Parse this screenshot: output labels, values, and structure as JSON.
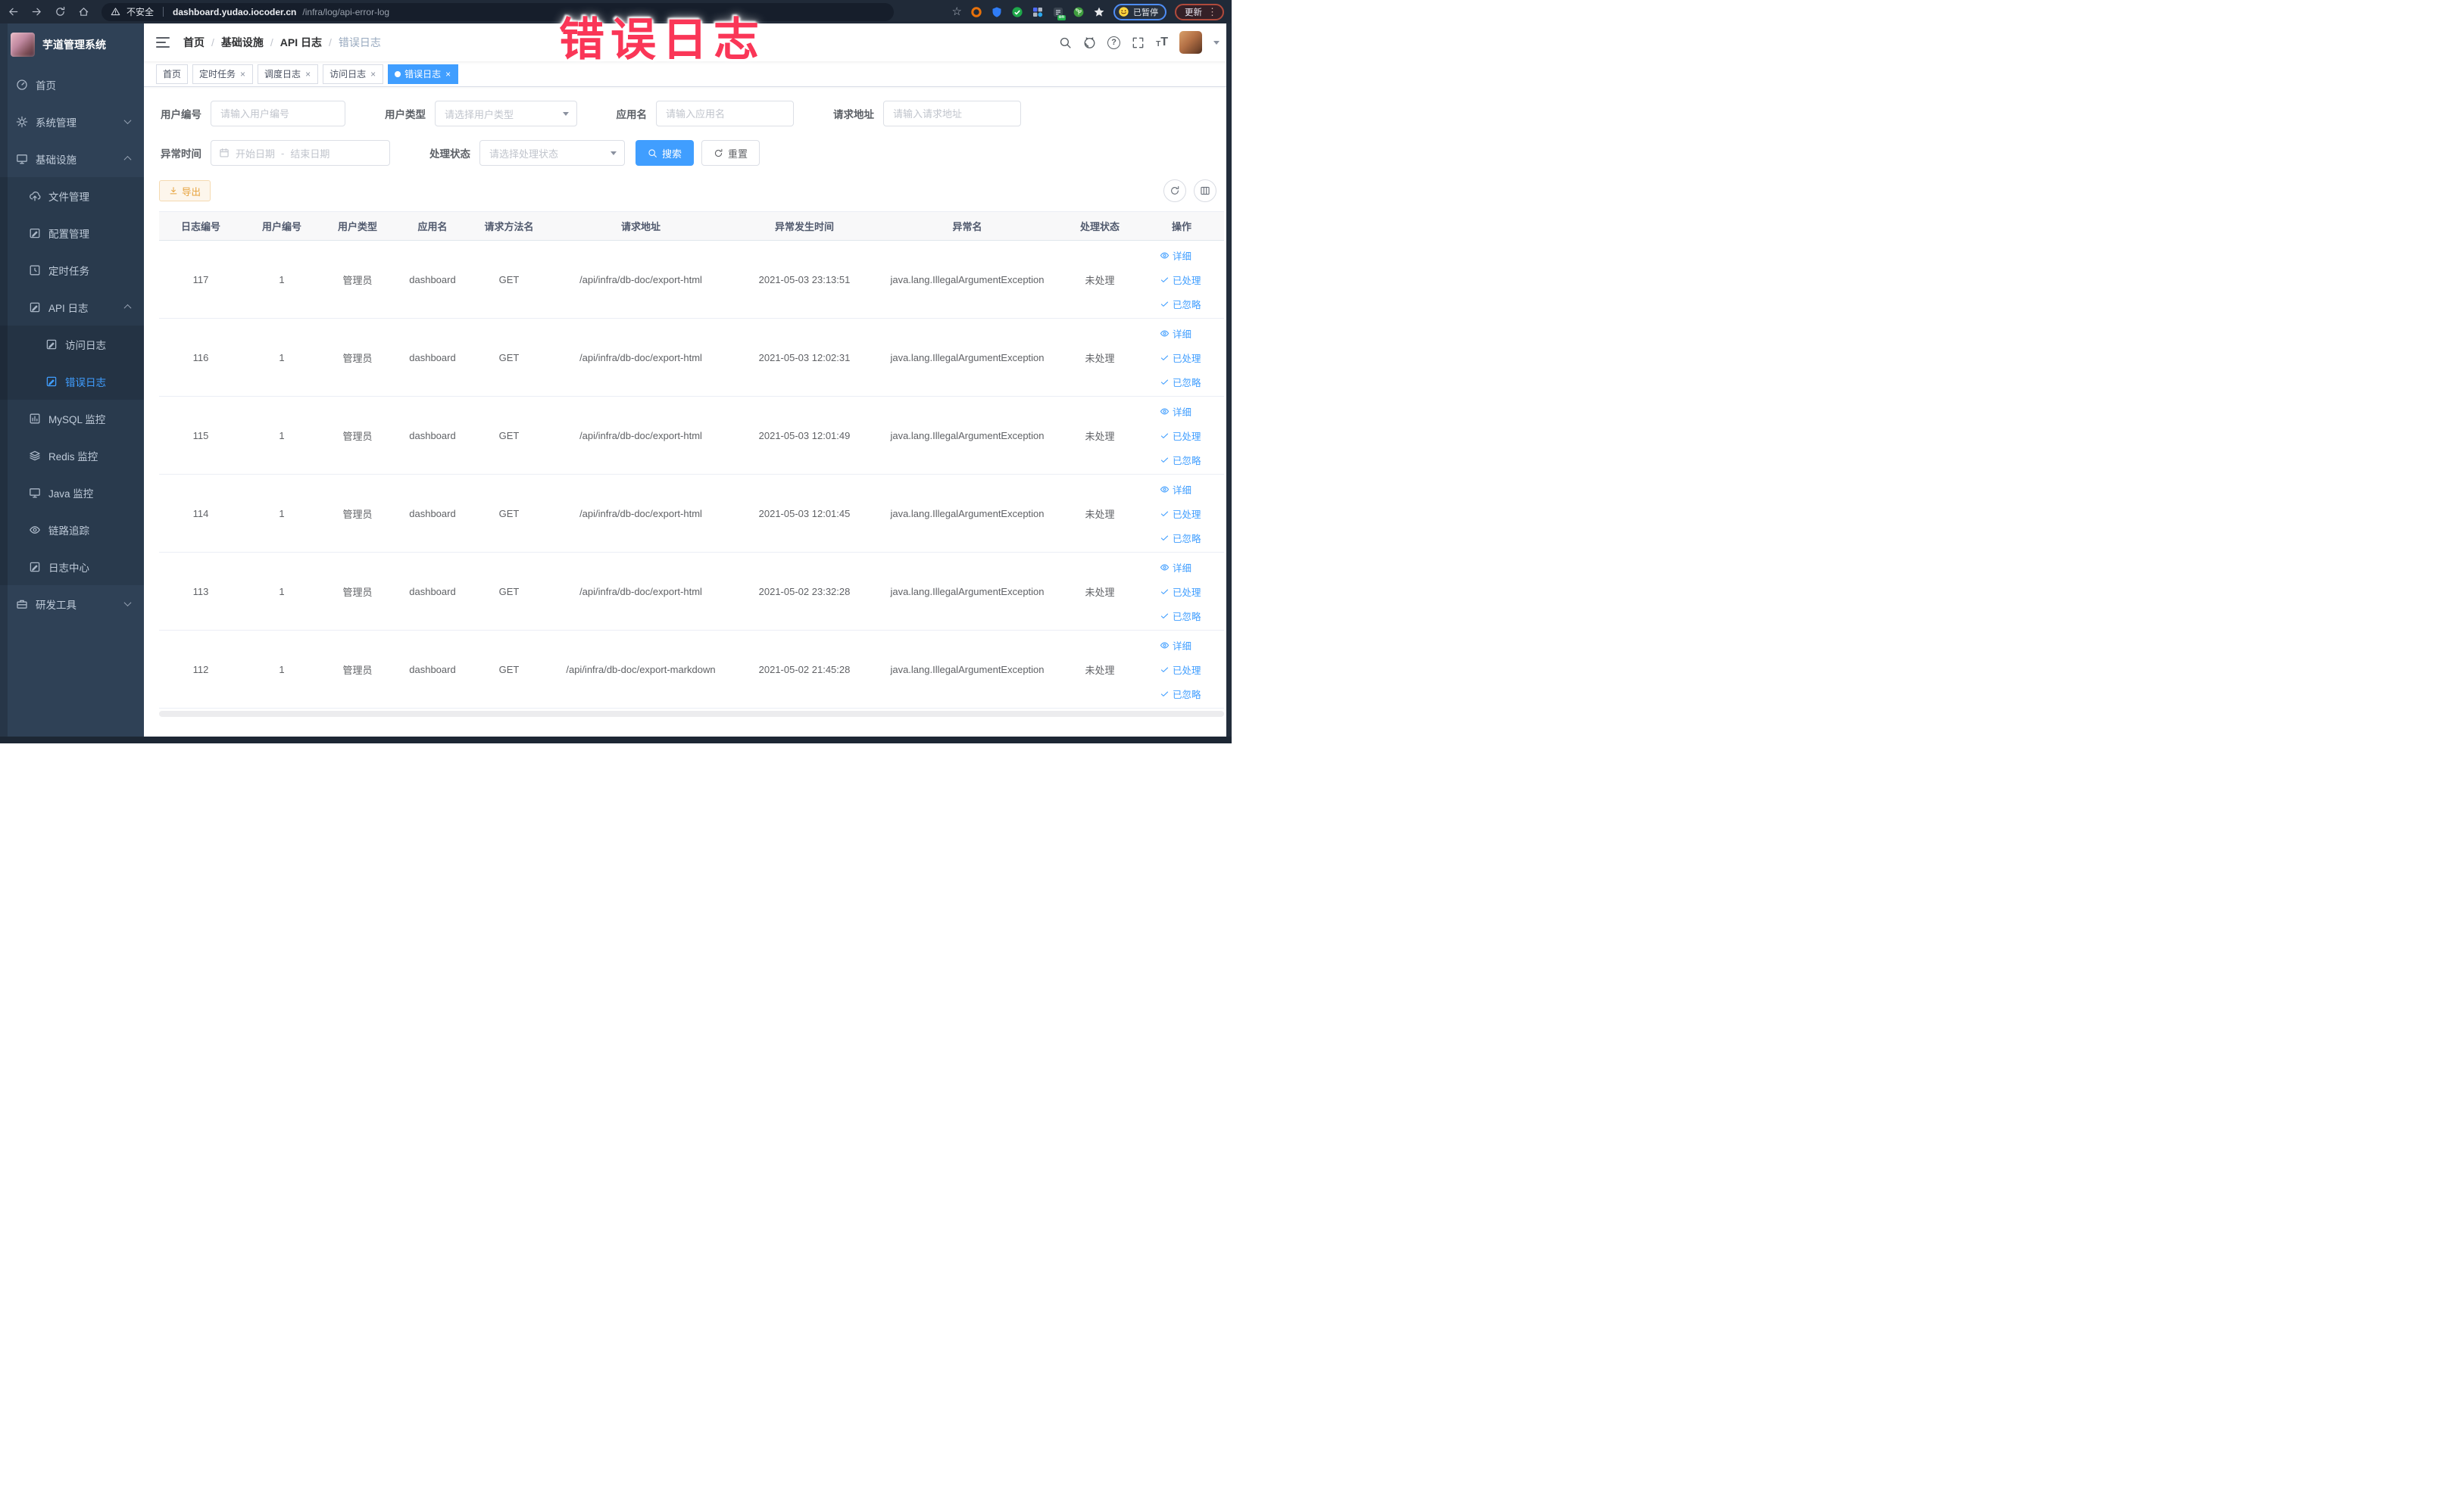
{
  "chrome": {
    "security_label": "不安全",
    "url_host": "dashboard.yudao.iocoder.cn",
    "url_path": "/infra/log/api-error-log",
    "bookmark_glyph": "☆",
    "extensions": [
      {
        "name": "orange-ring-extension-icon"
      },
      {
        "name": "shield-extension-icon"
      },
      {
        "name": "green-check-extension-icon"
      },
      {
        "name": "grid-extension-icon"
      },
      {
        "name": "on-badge-extension-icon",
        "badge": "on"
      },
      {
        "name": "leaf-extension-icon"
      },
      {
        "name": "star-extension-icon"
      }
    ],
    "paused_badge": "已暂停",
    "update_button": "更新",
    "more_glyph": "⋮"
  },
  "annotation": {
    "text": "错误日志",
    "color": "#fa3657"
  },
  "sidebar": {
    "title": "芋道管理系统",
    "items": [
      {
        "key": "home",
        "label": "首页",
        "icon": "dashboard-icon",
        "level": 1
      },
      {
        "key": "system",
        "label": "系统管理",
        "icon": "gear-icon",
        "level": 1,
        "chevron": "down"
      },
      {
        "key": "infra",
        "label": "基础设施",
        "icon": "monitor-icon",
        "level": 1,
        "chevron": "up"
      },
      {
        "key": "file",
        "label": "文件管理",
        "icon": "cloud-upload-icon",
        "level": 2
      },
      {
        "key": "config",
        "label": "配置管理",
        "icon": "edit-square-icon",
        "level": 2
      },
      {
        "key": "job",
        "label": "定时任务",
        "icon": "timer-icon",
        "level": 2
      },
      {
        "key": "api-log",
        "label": "API 日志",
        "icon": "log-edit-icon",
        "level": 2,
        "chevron": "up"
      },
      {
        "key": "access-log",
        "label": "访问日志",
        "icon": "log-edit-icon",
        "level": 3
      },
      {
        "key": "error-log",
        "label": "错误日志",
        "icon": "log-edit-icon",
        "level": 3,
        "active": true
      },
      {
        "key": "mysql",
        "label": "MySQL 监控",
        "icon": "chart-icon",
        "level": 2
      },
      {
        "key": "redis",
        "label": "Redis 监控",
        "icon": "layers-icon",
        "level": 2
      },
      {
        "key": "java",
        "label": "Java 监控",
        "icon": "monitor-icon",
        "level": 2
      },
      {
        "key": "trace",
        "label": "链路追踪",
        "icon": "eye-icon",
        "level": 2
      },
      {
        "key": "log-center",
        "label": "日志中心",
        "icon": "log-edit-icon",
        "level": 2
      },
      {
        "key": "devtools",
        "label": "研发工具",
        "icon": "briefcase-icon",
        "level": 1,
        "chevron": "down"
      }
    ]
  },
  "navbar": {
    "breadcrumb": [
      "首页",
      "基础设施",
      "API 日志",
      "错误日志"
    ],
    "separator": "/",
    "help_glyph": "?",
    "fontsize_glyph": "T"
  },
  "tags": {
    "close_glyph": "×",
    "items": [
      {
        "key": "home",
        "label": "首页",
        "closable": false,
        "active": false
      },
      {
        "key": "job",
        "label": "定时任务",
        "closable": true,
        "active": false
      },
      {
        "key": "job-log",
        "label": "调度日志",
        "closable": true,
        "active": false
      },
      {
        "key": "api-access-log",
        "label": "访问日志",
        "closable": true,
        "active": false
      },
      {
        "key": "api-error-log",
        "label": "错误日志",
        "closable": true,
        "active": true
      }
    ]
  },
  "filters": {
    "user_id": {
      "label": "用户编号",
      "placeholder": "请输入用户编号"
    },
    "user_type": {
      "label": "用户类型",
      "placeholder": "请选择用户类型"
    },
    "app_name": {
      "label": "应用名",
      "placeholder": "请输入应用名"
    },
    "request_url": {
      "label": "请求地址",
      "placeholder": "请输入请求地址"
    },
    "exception_time": {
      "label": "异常时间",
      "start_placeholder": "开始日期",
      "separator": "-",
      "end_placeholder": "结束日期"
    },
    "process_status": {
      "label": "处理状态",
      "placeholder": "请选择处理状态"
    },
    "search_button": "搜索",
    "reset_button": "重置"
  },
  "toolbar": {
    "export_button": "导出"
  },
  "table": {
    "columns": [
      "日志编号",
      "用户编号",
      "用户类型",
      "应用名",
      "请求方法名",
      "请求地址",
      "异常发生时间",
      "异常名",
      "处理状态",
      "操作"
    ],
    "row_actions": [
      {
        "label": "详细",
        "icon": "eye-icon"
      },
      {
        "label": "已处理",
        "icon": "check-icon"
      },
      {
        "label": "已忽略",
        "icon": "check-icon"
      }
    ],
    "rows": [
      {
        "id": "117",
        "user_id": "1",
        "user_type": "管理员",
        "app_name": "dashboard",
        "method": "GET",
        "url": "/api/infra/db-doc/export-html",
        "time": "2021-05-03 23:13:51",
        "exception": "java.lang.IllegalArgumentException",
        "status": "未处理"
      },
      {
        "id": "116",
        "user_id": "1",
        "user_type": "管理员",
        "app_name": "dashboard",
        "method": "GET",
        "url": "/api/infra/db-doc/export-html",
        "time": "2021-05-03 12:02:31",
        "exception": "java.lang.IllegalArgumentException",
        "status": "未处理"
      },
      {
        "id": "115",
        "user_id": "1",
        "user_type": "管理员",
        "app_name": "dashboard",
        "method": "GET",
        "url": "/api/infra/db-doc/export-html",
        "time": "2021-05-03 12:01:49",
        "exception": "java.lang.IllegalArgumentException",
        "status": "未处理"
      },
      {
        "id": "114",
        "user_id": "1",
        "user_type": "管理员",
        "app_name": "dashboard",
        "method": "GET",
        "url": "/api/infra/db-doc/export-html",
        "time": "2021-05-03 12:01:45",
        "exception": "java.lang.IllegalArgumentException",
        "status": "未处理"
      },
      {
        "id": "113",
        "user_id": "1",
        "user_type": "管理员",
        "app_name": "dashboard",
        "method": "GET",
        "url": "/api/infra/db-doc/export-html",
        "time": "2021-05-02 23:32:28",
        "exception": "java.lang.IllegalArgumentException",
        "status": "未处理"
      },
      {
        "id": "112",
        "user_id": "1",
        "user_type": "管理员",
        "app_name": "dashboard",
        "method": "GET",
        "url": "/api/infra/db-doc/export-markdown",
        "time": "2021-05-02 21:45:28",
        "exception": "java.lang.IllegalArgumentException",
        "status": "未处理"
      }
    ]
  },
  "colors": {
    "accent_blue": "#409eff",
    "warning_orange": "#e6a23c",
    "sidebar_bg": "#2f4156",
    "chrome_bg": "#202a38",
    "annotation_red": "#fa3657"
  }
}
